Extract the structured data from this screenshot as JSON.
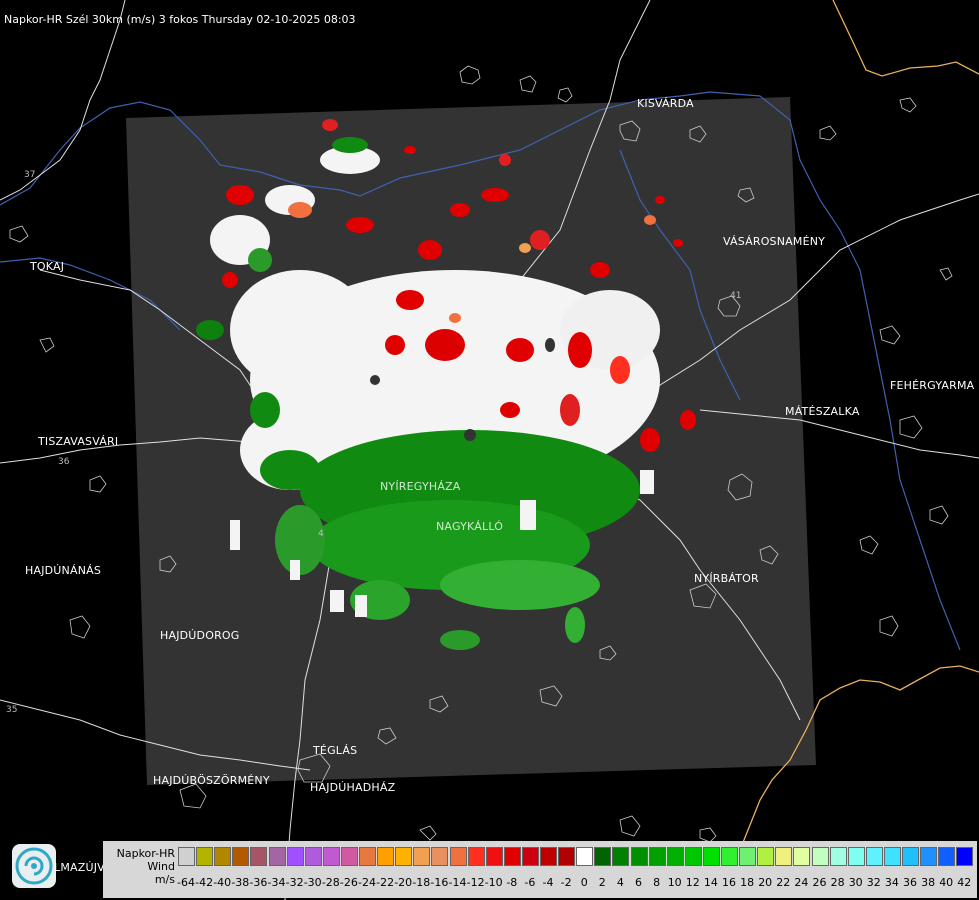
{
  "title": "Napkor-HR Szél 30km (m/s) 3 fokos Thursday 02-10-2025 08:03",
  "cities": [
    {
      "id": "kisvarda",
      "name": "KISVÁRDA"
    },
    {
      "id": "tokaj",
      "name": "TOKAJ"
    },
    {
      "id": "vasarosnameny",
      "name": "VÁSÁROSNAMÉNY"
    },
    {
      "id": "fehergyarmat",
      "name": "FEHÉRGYARMA"
    },
    {
      "id": "mateszalka",
      "name": "MÁTÉSZALKA"
    },
    {
      "id": "tiszavasvari",
      "name": "TISZAVASVÁRI"
    },
    {
      "id": "nyiregyhaza",
      "name": "NYÍREGYHÁZA"
    },
    {
      "id": "nagykallo",
      "name": "NAGYKÁLLÓ"
    },
    {
      "id": "hajdunanas",
      "name": "HAJDÚNÁNÁS"
    },
    {
      "id": "nyirbator",
      "name": "NYÍRBÁTOR"
    },
    {
      "id": "hajdudorog",
      "name": "HAJDÚDOROG"
    },
    {
      "id": "teglas",
      "name": "TÉGLÁS"
    },
    {
      "id": "hajduboszormeny",
      "name": "HAJDÚBÖSZÖRMÉNY"
    },
    {
      "id": "hajduhadhaz",
      "name": "HAJDÚHADHÁZ"
    },
    {
      "id": "balmazujvaros",
      "name": "LMAZÚJVÁR"
    }
  ],
  "road_numbers": [
    "37",
    "41",
    "36",
    "35",
    "4"
  ],
  "legend": {
    "line1": "Napkor-HR",
    "line2": "Wind",
    "line3": "m/s",
    "ticks": [
      "-64",
      "-42",
      "-40",
      "-38",
      "-36",
      "-34",
      "-32",
      "-30",
      "-28",
      "-26",
      "-24",
      "-22",
      "-20",
      "-18",
      "-16",
      "-14",
      "-12",
      "-10",
      "-8",
      "-6",
      "-4",
      "-2",
      "0",
      "2",
      "4",
      "6",
      "8",
      "10",
      "12",
      "14",
      "16",
      "18",
      "20",
      "22",
      "24",
      "26",
      "28",
      "30",
      "32",
      "34",
      "36",
      "38",
      "40",
      "42"
    ],
    "colors": [
      "#d0d0d0",
      "#b3b300",
      "#b38600",
      "#b35900",
      "#a65566",
      "#a366a3",
      "#a050ff",
      "#b05adc",
      "#c05ad0",
      "#d05aa0",
      "#e67840",
      "#ffa000",
      "#ffb000",
      "#f0a050",
      "#e89060",
      "#f07040",
      "#ff3020",
      "#f01010",
      "#e00000",
      "#cc0010",
      "#c00000",
      "#b00000",
      "#ffffff",
      "#006400",
      "#008000",
      "#009000",
      "#00a000",
      "#00b000",
      "#00c800",
      "#00e000",
      "#30f030",
      "#70f070",
      "#b0f040",
      "#f0f080",
      "#e0ffa0",
      "#c0ffc0",
      "#a0ffe0",
      "#80fff0",
      "#60f0ff",
      "#40e0ff",
      "#20c0ff",
      "#2090ff",
      "#1060ff",
      "#0000ff"
    ]
  },
  "logo": {
    "icon": "omsz-logo-icon"
  }
}
